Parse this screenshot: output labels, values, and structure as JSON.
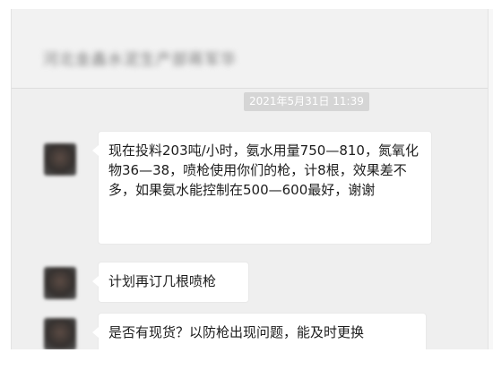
{
  "header": {
    "title": "河北金鑫水泥生产部蒋军华"
  },
  "conversation": {
    "timestamp": "2021年5月31日 11:39",
    "messages": [
      {
        "text": "现在投料203吨/小时，氨水用量750—810，氮氧化物36—38，喷枪使用你们的枪，计8根，效果差不多，如果氨水能控制在500—600最好，谢谢"
      },
      {
        "text": "计划再订几根喷枪"
      },
      {
        "text": "是否有现货？以防枪出现问题，能及时更换"
      }
    ]
  },
  "colors": {
    "window_background": "#efefef",
    "bubble_background": "#ffffff",
    "timestamp_background": "#d5d5d5",
    "text": "#1d1d1d"
  }
}
